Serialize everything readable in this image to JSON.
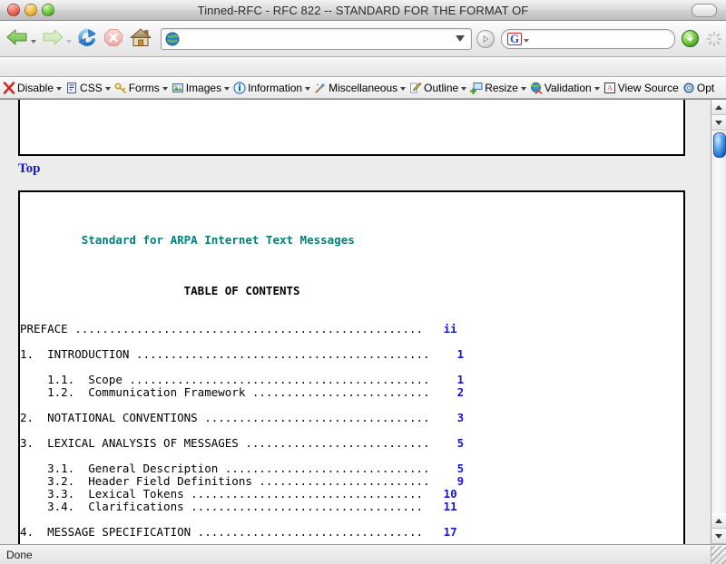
{
  "window": {
    "title": "Tinned-RFC - RFC 822 -- STANDARD FOR THE FORMAT OF",
    "controls": {
      "close": "close-button",
      "minimize": "minimize-button",
      "zoom": "zoom-button",
      "toolbar_toggle": "toolbar-toggle-button"
    }
  },
  "navbar": {
    "back_label": "Back",
    "forward_label": "Forward",
    "reload_label": "Reload",
    "stop_label": "Stop",
    "home_label": "Home",
    "url_value": "",
    "url_placeholder": "",
    "go_label": "Go",
    "search_value": "",
    "search_placeholder": "",
    "search_engine": "G",
    "download_label": "Downloads",
    "throbber_label": "Activity indicator"
  },
  "bookmarks_toolbar": {
    "items": []
  },
  "devtoolbar": {
    "items": [
      {
        "label": "Disable",
        "icon": "red-x-icon",
        "has_menu": true
      },
      {
        "label": "CSS",
        "icon": "css-document-icon",
        "has_menu": true
      },
      {
        "label": "Forms",
        "icon": "forms-key-icon",
        "has_menu": true
      },
      {
        "label": "Images",
        "icon": "images-picture-icon",
        "has_menu": true
      },
      {
        "label": "Information",
        "icon": "information-icon",
        "has_menu": true
      },
      {
        "label": "Miscellaneous",
        "icon": "miscellaneous-wand-icon",
        "has_menu": true
      },
      {
        "label": "Outline",
        "icon": "outline-pencil-icon",
        "has_menu": true
      },
      {
        "label": "Resize",
        "icon": "resize-icon",
        "has_menu": true
      },
      {
        "label": "Validation",
        "icon": "validation-globe-icon",
        "has_menu": true
      },
      {
        "label": "View Source",
        "icon": "view-source-icon",
        "has_menu": false
      },
      {
        "label": "Opt",
        "icon": "options-gear-icon",
        "has_menu": false
      }
    ]
  },
  "page": {
    "top_link": "Top",
    "heading": "Standard for ARPA Internet Text Messages",
    "toc_title": "TABLE OF CONTENTS",
    "toc": [
      {
        "number": "",
        "title": "PREFACE",
        "page": "ii",
        "indent": 0,
        "gap_before": 0
      },
      {
        "number": "1.",
        "title": "INTRODUCTION",
        "page": "1",
        "indent": 0,
        "gap_before": 1
      },
      {
        "number": "1.1.",
        "title": "Scope",
        "page": "1",
        "indent": 1,
        "gap_before": 1
      },
      {
        "number": "1.2.",
        "title": "Communication Framework",
        "page": "2",
        "indent": 1,
        "gap_before": 0
      },
      {
        "number": "2.",
        "title": "NOTATIONAL CONVENTIONS",
        "page": "3",
        "indent": 0,
        "gap_before": 1
      },
      {
        "number": "3.",
        "title": "LEXICAL ANALYSIS OF MESSAGES",
        "page": "5",
        "indent": 0,
        "gap_before": 1
      },
      {
        "number": "3.1.",
        "title": "General Description",
        "page": "5",
        "indent": 1,
        "gap_before": 1
      },
      {
        "number": "3.2.",
        "title": "Header Field Definitions",
        "page": "9",
        "indent": 1,
        "gap_before": 0
      },
      {
        "number": "3.3.",
        "title": "Lexical Tokens",
        "page": "10",
        "indent": 1,
        "gap_before": 0
      },
      {
        "number": "3.4.",
        "title": "Clarifications",
        "page": "11",
        "indent": 1,
        "gap_before": 0
      },
      {
        "number": "4.",
        "title": "MESSAGE SPECIFICATION",
        "page": "17",
        "indent": 0,
        "gap_before": 1
      }
    ]
  },
  "scrollbar": {
    "up_label": "Scroll up",
    "down_label": "Scroll down",
    "thumb_label": "Vertical scroll thumb"
  },
  "statusbar": {
    "text": "Done",
    "grip_label": "Resize grip"
  },
  "colors": {
    "heading_teal": "#00807e",
    "link_blue": "#1414e0",
    "page_background": "#ececec",
    "doc_background": "#ffffff"
  }
}
